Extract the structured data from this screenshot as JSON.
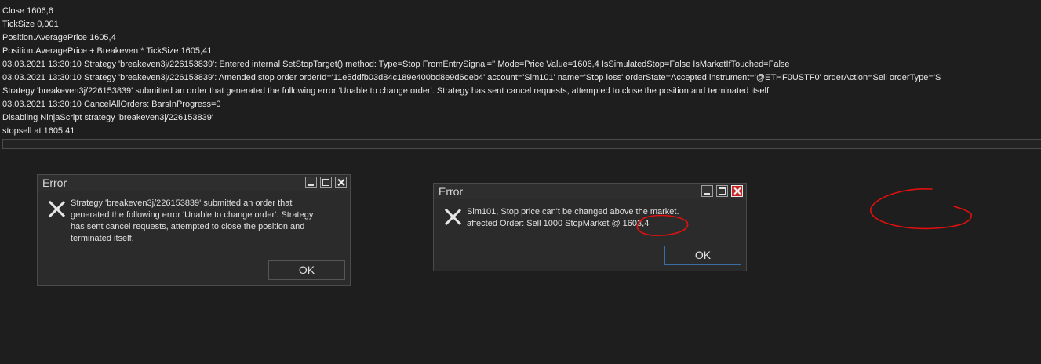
{
  "log": {
    "lines": [
      "Close 1606,6",
      "TickSize 0,001",
      " Position.AveragePrice 1605,4",
      " Position.AveragePrice + Breakeven * TickSize 1605,41",
      "03.03.2021 13:30:10 Strategy 'breakeven3j/226153839': Entered internal SetStopTarget() method: Type=Stop FromEntrySignal='' Mode=Price Value=1606,4 IsSimulatedStop=False IsMarketIfTouched=False",
      "03.03.2021 13:30:10 Strategy 'breakeven3j/226153839': Amended stop order orderId='11e5ddfb03d84c189e400bd8e9d6deb4' account='Sim101' name='Stop loss' orderState=Accepted instrument='@ETHF0USTF0' orderAction=Sell orderType='S",
      "Strategy 'breakeven3j/226153839' submitted an order that generated the following error 'Unable to change order'. Strategy has sent cancel requests, attempted to close the position and terminated itself.",
      "03.03.2021 13:30:10 CancelAllOrders: BarsInProgress=0",
      "Disabling NinjaScript strategy 'breakeven3j/226153839'",
      "stopsell  at 1605,41"
    ]
  },
  "dialog1": {
    "title": "Error",
    "icon": "error-x-icon",
    "message_lines": [
      "Strategy 'breakeven3j/226153839' submitted an order that",
      "generated the following error 'Unable to change order'. Strategy",
      "has sent cancel requests, attempted to close the position and",
      "terminated itself."
    ],
    "ok_label": "OK"
  },
  "dialog2": {
    "title": "Error",
    "icon": "error-x-icon",
    "message_lines": [
      "Sim101, Stop price can't be changed above the market.",
      "affected Order: Sell 1000 StopMarket @ 1603,4"
    ],
    "ok_label": "OK"
  },
  "colors": {
    "background": "#1e1e1e",
    "dialog_bg": "#2b2b2b",
    "close_button_active": "#c62828",
    "annotation": "#e01010",
    "focus_border": "#3a6ea5"
  }
}
